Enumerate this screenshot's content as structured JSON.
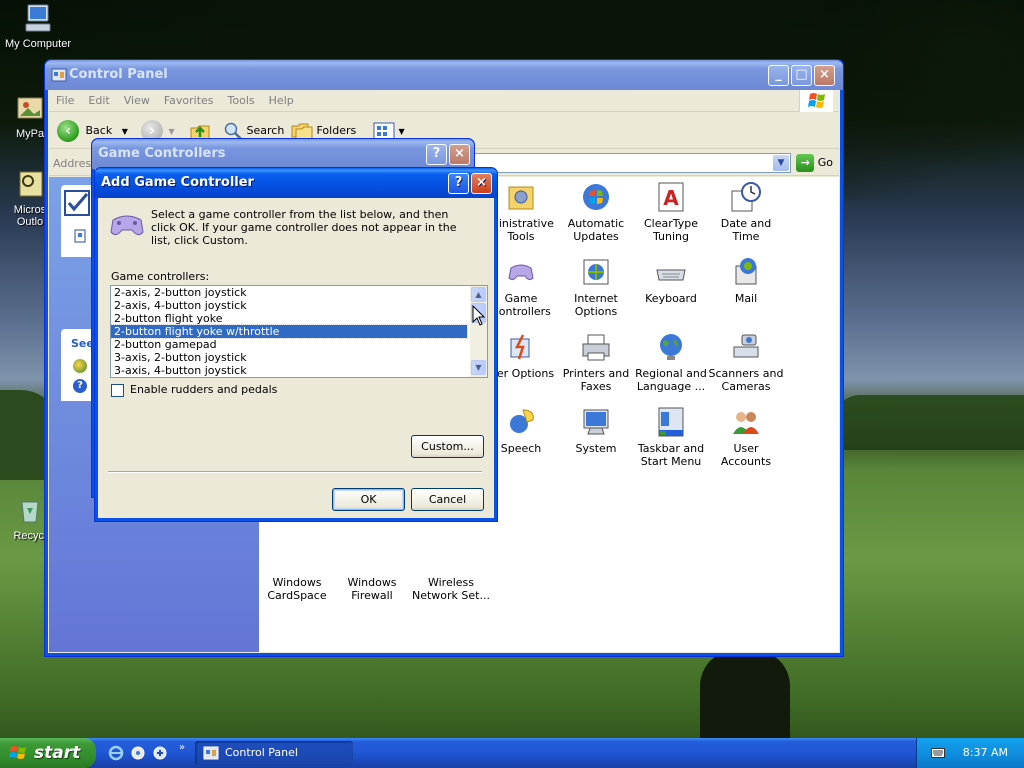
{
  "desktop": {
    "icons": [
      {
        "label": "My Computer"
      },
      {
        "label": "MyPa"
      },
      {
        "label": "Micros"
      },
      {
        "label": "Outlo"
      },
      {
        "label": "Recycl"
      }
    ]
  },
  "control_panel": {
    "title": "Control Panel",
    "menu": [
      "File",
      "Edit",
      "View",
      "Favorites",
      "Tools",
      "Help"
    ],
    "toolbar": {
      "back": "Back",
      "search": "Search",
      "folders": "Folders"
    },
    "address_label": "Address",
    "go_label": "Go",
    "taskpane_see": "See",
    "items": [
      {
        "line1": "ministrative",
        "line2": "Tools",
        "icon": "administrative-tools-icon"
      },
      {
        "line1": "Automatic",
        "line2": "Updates",
        "icon": "automatic-updates-icon"
      },
      {
        "line1": "ClearType",
        "line2": "Tuning",
        "icon": "cleartype-icon"
      },
      {
        "line1": "Date and Time",
        "line2": "",
        "icon": "date-time-icon"
      },
      {
        "line1": "Game",
        "line2": "Controllers",
        "icon": "game-controller-icon"
      },
      {
        "line1": "Internet",
        "line2": "Options",
        "icon": "internet-options-icon"
      },
      {
        "line1": "Keyboard",
        "line2": "",
        "icon": "keyboard-icon"
      },
      {
        "line1": "Mail",
        "line2": "",
        "icon": "mail-icon"
      },
      {
        "line1": "wer Options",
        "line2": "",
        "icon": "power-options-icon"
      },
      {
        "line1": "Printers and",
        "line2": "Faxes",
        "icon": "printer-icon"
      },
      {
        "line1": "Regional and",
        "line2": "Language ...",
        "icon": "globe-icon"
      },
      {
        "line1": "Scanners and",
        "line2": "Cameras",
        "icon": "scanner-icon"
      },
      {
        "line1": "Speech",
        "line2": "",
        "icon": "speech-icon"
      },
      {
        "line1": "System",
        "line2": "",
        "icon": "system-icon"
      },
      {
        "line1": "Taskbar and",
        "line2": "Start Menu",
        "icon": "taskbar-icon"
      },
      {
        "line1": "User Accounts",
        "line2": "",
        "icon": "user-accounts-icon"
      },
      {
        "line1": "Windows",
        "line2": "CardSpace",
        "icon": "cardspace-icon"
      },
      {
        "line1": "Windows",
        "line2": "Firewall",
        "icon": "firewall-icon"
      },
      {
        "line1": "Wireless",
        "line2": "Network Set...",
        "icon": "wireless-icon"
      }
    ]
  },
  "game_controllers": {
    "title": "Game Controllers"
  },
  "add_dialog": {
    "title": "Add Game Controller",
    "instruction": "Select a game controller from the list below, and then click OK.  If your game controller does not appear in the list, click Custom.",
    "list_label": "Game controllers:",
    "controllers": [
      "2-axis, 2-button joystick",
      "2-axis, 4-button joystick",
      "2-button flight yoke",
      "2-button flight yoke w/throttle",
      "2-button gamepad",
      "3-axis, 2-button joystick",
      "3-axis, 4-button joystick"
    ],
    "selected_index": 3,
    "rudder_label": "Enable rudders and pedals",
    "rudder_checked": false,
    "custom_label": "Custom...",
    "ok_label": "OK",
    "cancel_label": "Cancel"
  },
  "taskbar": {
    "start_label": "start",
    "task_label": "Control Panel",
    "clock": "8:37 AM"
  }
}
